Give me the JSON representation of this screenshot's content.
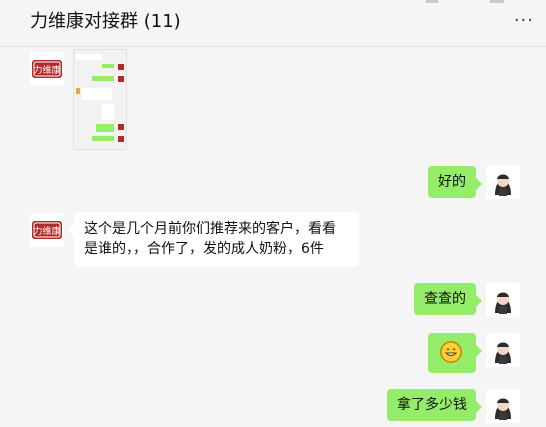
{
  "header": {
    "title": "力维康对接群 (11)",
    "more_icon": "more-icon",
    "more_glyph": "···"
  },
  "brand": {
    "name": "力维康",
    "colors": {
      "badge_bg": "#b22b2b",
      "badge_text": "#ffffff"
    }
  },
  "messages": [
    {
      "side": "left",
      "sender": "brand",
      "type": "image",
      "desc": "chat-screenshot"
    },
    {
      "side": "right",
      "sender": "user",
      "type": "text",
      "text": "好的"
    },
    {
      "side": "left",
      "sender": "brand",
      "type": "text",
      "text": "这个是几个月前你们推荐来的客户，看看是谁的，，合作了，发的成人奶粉，6件"
    },
    {
      "side": "right",
      "sender": "user",
      "type": "text",
      "text": "查查的"
    },
    {
      "side": "right",
      "sender": "user",
      "type": "emoji",
      "emoji": "😄"
    },
    {
      "side": "right",
      "sender": "user",
      "type": "text",
      "text": "拿了多少钱"
    }
  ]
}
